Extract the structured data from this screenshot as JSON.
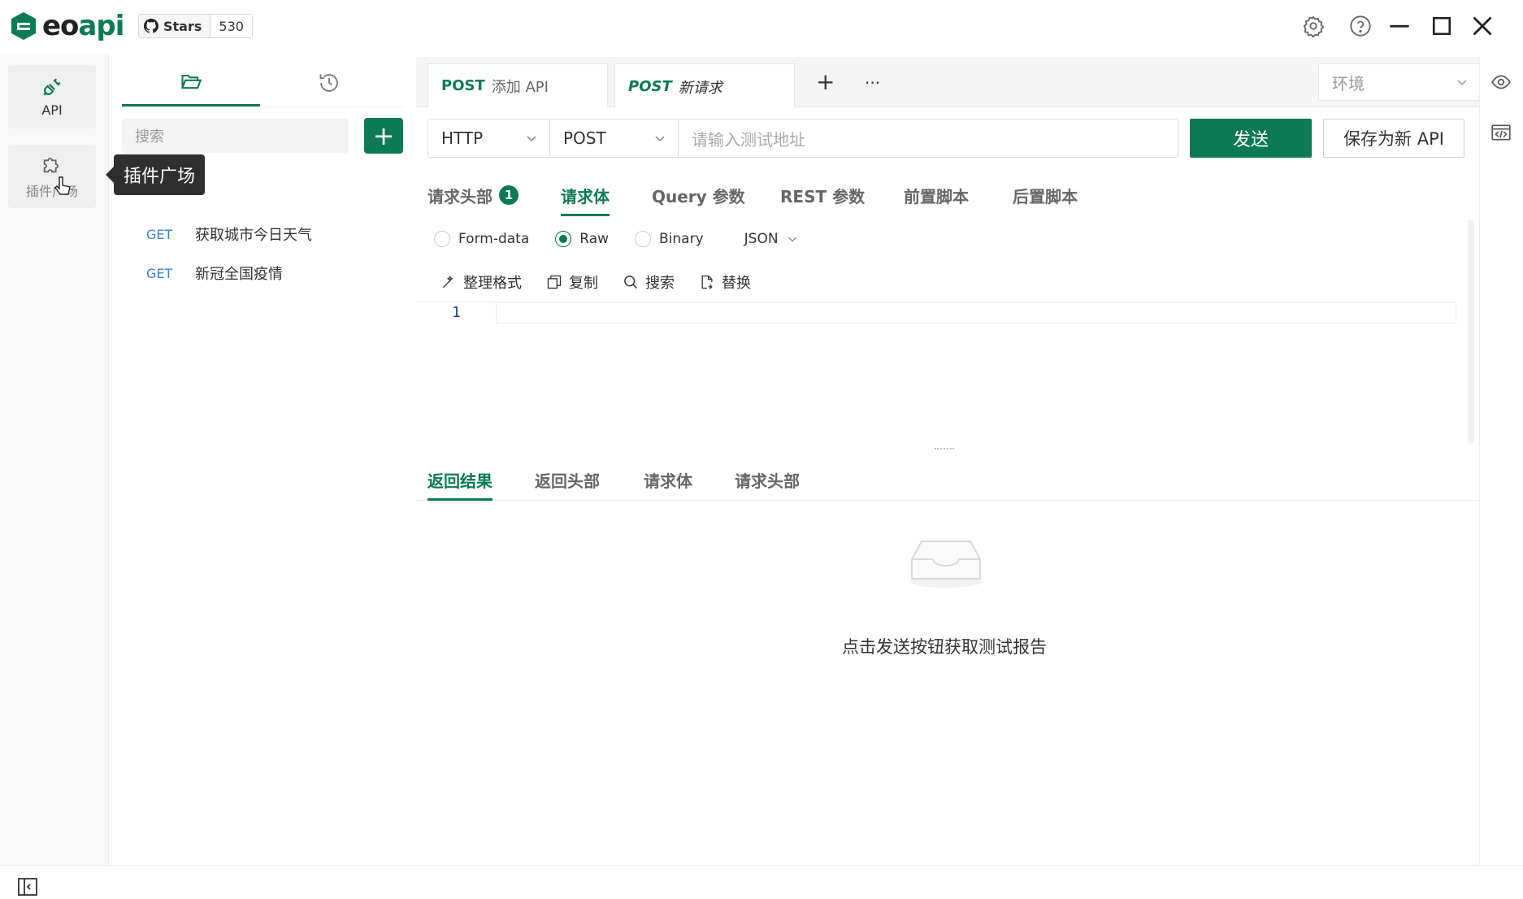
{
  "app": {
    "logo_prefix": "eo",
    "logo_suffix": "api"
  },
  "github": {
    "stars_label": "Stars",
    "stars_count": "530"
  },
  "rail": {
    "api_label": "API",
    "plugin_label": "插件广场"
  },
  "tooltip": {
    "text": "插件广场"
  },
  "sidebar": {
    "search_placeholder": "搜索",
    "apis": [
      {
        "method": "GET",
        "name": "获取城市今日天气"
      },
      {
        "method": "GET",
        "name": "新冠全国疫情"
      }
    ]
  },
  "tabs": [
    {
      "method": "POST",
      "name": "添加 API"
    },
    {
      "method": "POST",
      "name": "新请求"
    }
  ],
  "tabbar": {
    "add": "+",
    "more": "···"
  },
  "env": {
    "placeholder": "环境"
  },
  "request": {
    "protocol": "HTTP",
    "method": "POST",
    "url_placeholder": "请输入测试地址",
    "send_label": "发送",
    "save_label": "保存为新 API"
  },
  "body_tabs": {
    "headers": "请求头部",
    "headers_badge": "1",
    "body": "请求体",
    "query": "Query 参数",
    "rest": "REST 参数",
    "pre_script": "前置脚本",
    "post_script": "后置脚本"
  },
  "body_types": {
    "form": "Form-data",
    "raw": "Raw",
    "binary": "Binary",
    "format": "JSON"
  },
  "editor_tools": {
    "format": "整理格式",
    "copy": "复制",
    "search": "搜索",
    "replace": "替换"
  },
  "editor": {
    "line1": "1"
  },
  "response_tabs": {
    "result": "返回结果",
    "headers": "返回头部",
    "body": "请求体",
    "req_headers": "请求头部"
  },
  "response": {
    "empty": "点击发送按钮获取测试报告"
  },
  "colors": {
    "accent": "#0b7a55",
    "get": "#3b82c4"
  }
}
